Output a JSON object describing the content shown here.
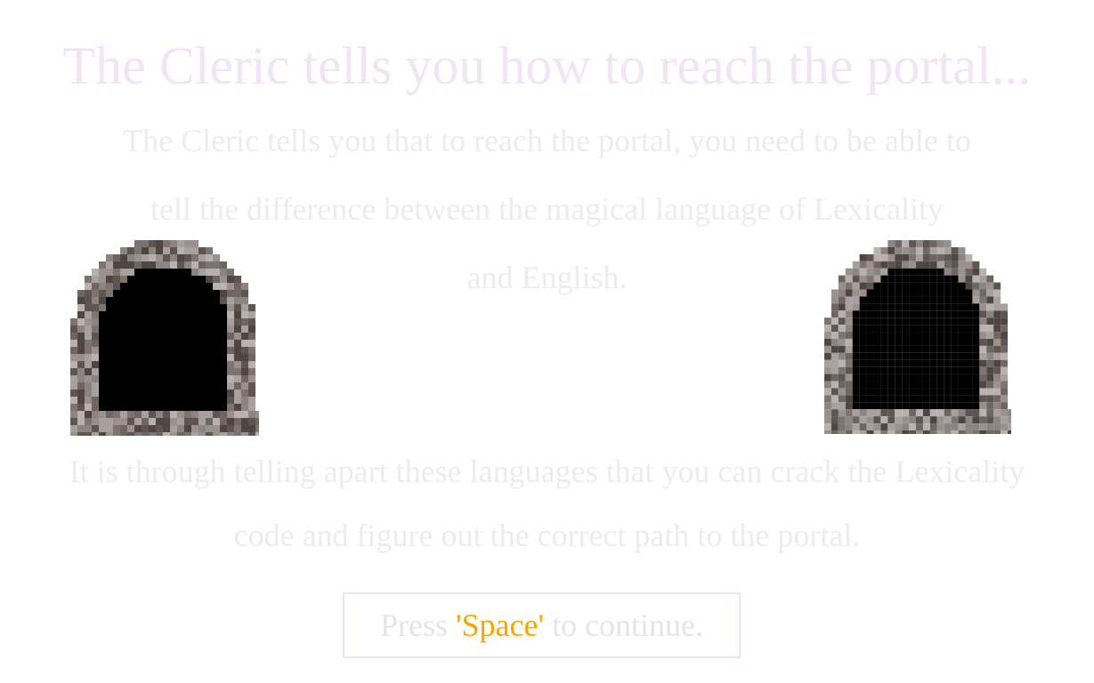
{
  "screen": {
    "title": "The Cleric tells you how to reach the portal...",
    "paragraph1": [
      "The Cleric tells you that to reach the portal, you need to be able to",
      "tell the difference between the magical language of Lexicality",
      "and English."
    ],
    "paragraph2": [
      "It is through telling apart these languages that you can crack the Lexicality",
      "code and figure out the correct path to the portal."
    ]
  },
  "prompt": {
    "before": "Press ",
    "key": "'Space'",
    "after": " to continue."
  },
  "colors": {
    "title": "#f3e3f6",
    "text": "#ececec",
    "key_highlight": "#f7a400",
    "prompt_border": "#efe0f4",
    "portal_interior": "#000000"
  },
  "icons": {
    "left_portal": "stone-archway-portal",
    "right_portal": "stone-archway-portal"
  }
}
